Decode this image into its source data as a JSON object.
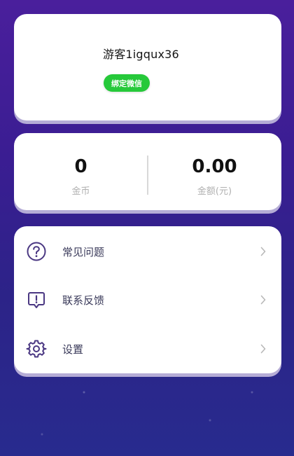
{
  "profile": {
    "username": "游客1igqux36",
    "bind_wechat_label": "绑定微信"
  },
  "stats": {
    "coins": {
      "value": "0",
      "label": "金币"
    },
    "amount": {
      "value": "0.00",
      "label": "金额(元)"
    }
  },
  "menu": {
    "items": [
      {
        "label": "常见问题",
        "icon": "question-circle-icon"
      },
      {
        "label": "联系反馈",
        "icon": "feedback-icon"
      },
      {
        "label": "设置",
        "icon": "gear-icon"
      }
    ]
  },
  "colors": {
    "accent_green": "#26c93a",
    "icon_purple": "#4a3782",
    "bg_top": "#4a1f9c",
    "bg_bottom": "#282b8e"
  }
}
